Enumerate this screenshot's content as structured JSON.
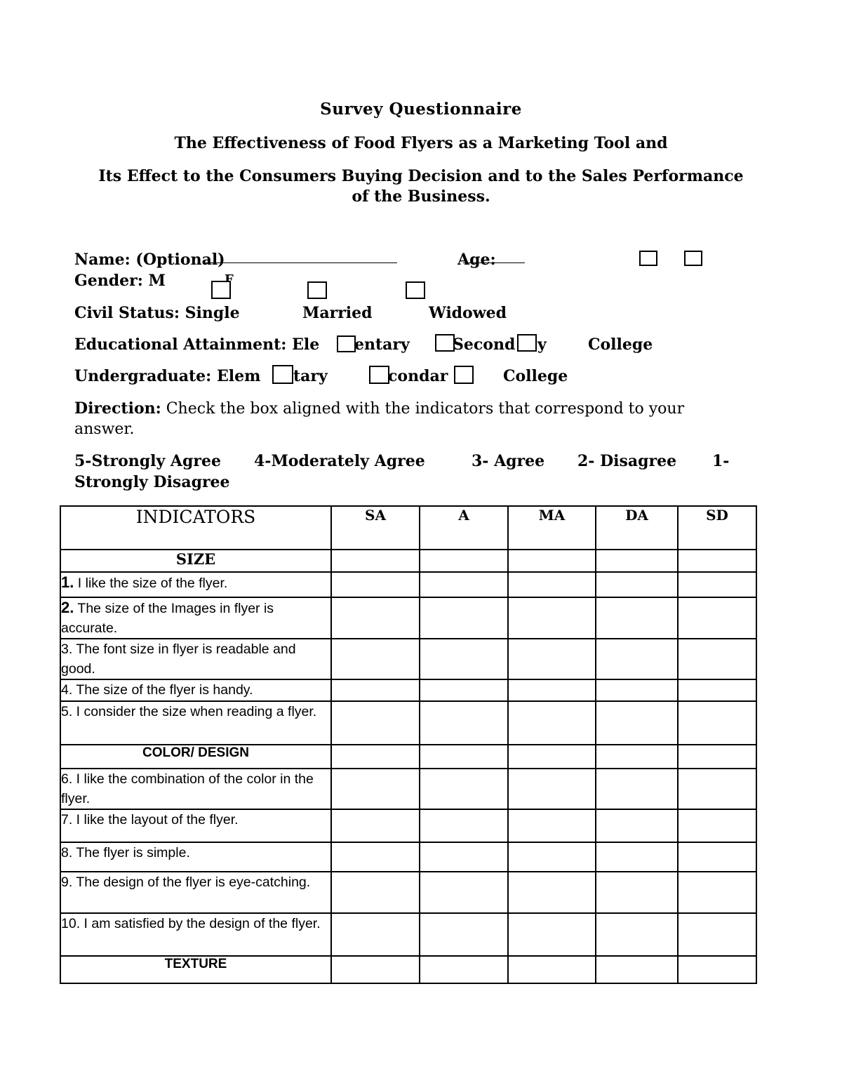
{
  "document": {
    "title": "Survey Questionnaire",
    "subtitle_line1": "The Effectiveness of Food Flyers as a Marketing Tool and",
    "subtitle_line2": "Its Effect to the Consumers Buying Decision and to the Sales Performance",
    "subtitle_line3": "of the Business."
  },
  "profile": {
    "name_label": "Name: (Optional)",
    "age_label": "Age:",
    "gender_label": "Gender: M",
    "gender_f": "F",
    "civil_status_label": "Civil Status: Single",
    "civil_married": "Married",
    "civil_widowed": "Widowed",
    "education_label": "Educational Attainment: Ele",
    "education_elem_rest": "entary",
    "education_secondary_a": "Second",
    "education_secondary_b": "y",
    "education_college": "College",
    "undergrad_label": "Undergraduate: Elem",
    "undergrad_elem_rest": "tary",
    "undergrad_secondary": "condar",
    "undergrad_college": "College"
  },
  "direction": {
    "label": "Direction:",
    "text": " Check the box aligned with the indicators that correspond to your",
    "text2": "answer."
  },
  "scale": {
    "s5": "5-Strongly Agree",
    "s4": "4-Moderately Agree",
    "s3": "3- Agree",
    "s2": "2- Disagree",
    "s1a": "1-",
    "s1b": "Strongly Disagree"
  },
  "table": {
    "headers": [
      "INDICATORS",
      "SA",
      "A",
      "MA",
      "DA",
      "SD"
    ],
    "rows": [
      {
        "type": "section",
        "label": "SIZE"
      },
      {
        "type": "item",
        "num": "1.",
        "text": " I like the size of the flyer."
      },
      {
        "type": "item",
        "num": "2.",
        "text": "  The size of the Images in flyer is accurate."
      },
      {
        "type": "item",
        "num": "",
        "text": "3. The font size in flyer is readable and good."
      },
      {
        "type": "item",
        "num": "",
        "text": "4. The size of the flyer is handy."
      },
      {
        "type": "item",
        "num": "",
        "text": "5. I consider the size when reading a flyer."
      },
      {
        "type": "section",
        "label": "COLOR/ DESIGN"
      },
      {
        "type": "item",
        "num": "",
        "text": "6. I like the combination of the color in the flyer."
      },
      {
        "type": "item",
        "num": "",
        "text": "7. I like the layout of the flyer."
      },
      {
        "type": "item",
        "num": "",
        "text": "8. The flyer is simple."
      },
      {
        "type": "item",
        "num": "",
        "text": "9. The design of the flyer is eye-catching."
      },
      {
        "type": "item",
        "num": "",
        "text": "10. I am satisfied by the design of the flyer."
      },
      {
        "type": "section",
        "label": "TEXTURE"
      }
    ]
  }
}
